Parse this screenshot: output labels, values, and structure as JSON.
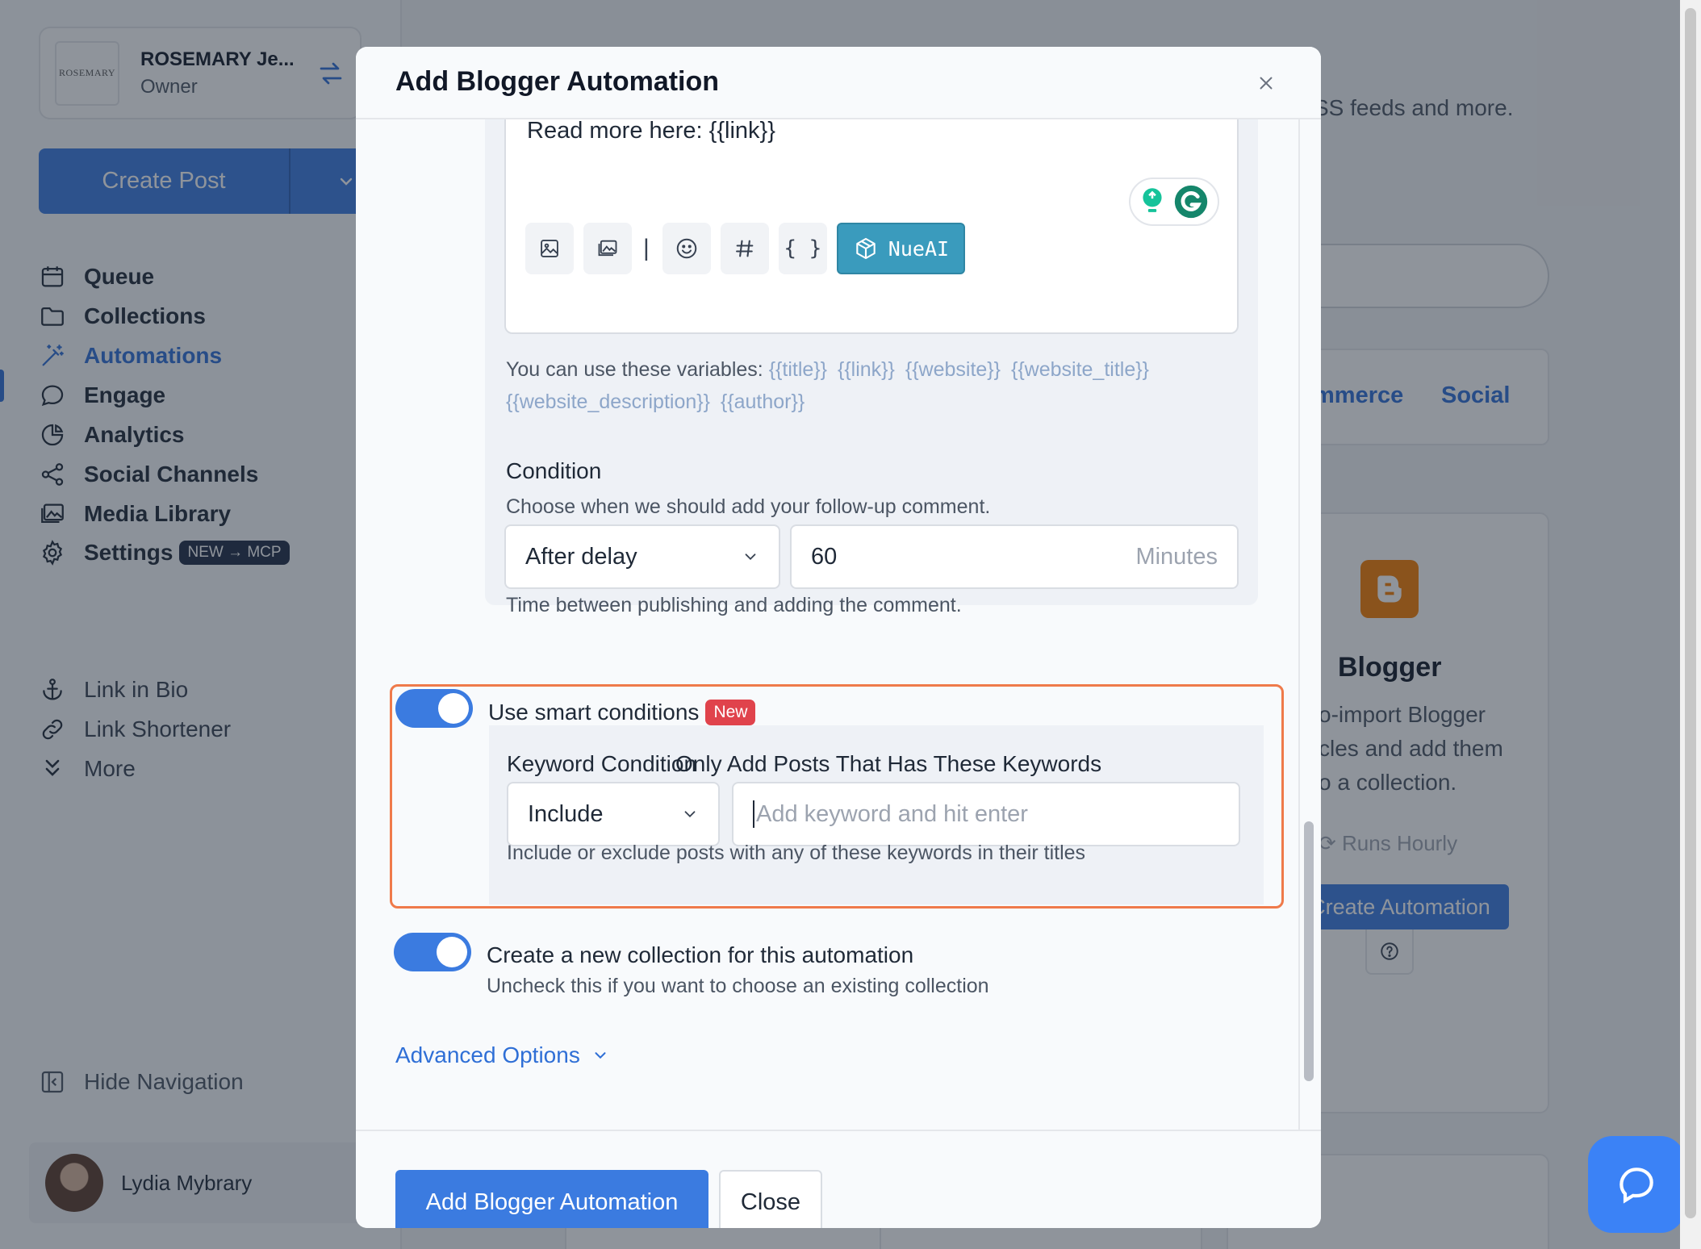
{
  "account": {
    "name": "ROSEMARY Je...",
    "role": "Owner",
    "logo_text": "ROSEMARY"
  },
  "sidebar": {
    "create_post": "Create Post",
    "items": [
      {
        "label": "Queue",
        "icon": "calendar-icon"
      },
      {
        "label": "Collections",
        "icon": "folder-icon"
      },
      {
        "label": "Automations",
        "icon": "magic-wand-icon"
      },
      {
        "label": "Engage",
        "icon": "chat-bubble-icon"
      },
      {
        "label": "Analytics",
        "icon": "pie-chart-icon"
      },
      {
        "label": "Social Channels",
        "icon": "share-icon"
      },
      {
        "label": "Media Library",
        "icon": "images-icon"
      },
      {
        "label": "Settings",
        "icon": "gear-icon",
        "badge": "NEW → MCP"
      },
      {
        "label": "Link in Bio",
        "icon": "anchor-icon"
      },
      {
        "label": "Link Shortener",
        "icon": "link-icon"
      },
      {
        "label": "More",
        "icon": "chevrons-down-icon"
      }
    ],
    "hide_navigation": "Hide Navigation",
    "user_name": "Lydia Mybrary"
  },
  "background": {
    "intro_fragment": "SS feeds and more.",
    "tab_fragment_1": "mmerce",
    "tab_fragment_2": "Social",
    "card_title": "Blogger",
    "card_desc_1": "o-import Blogger",
    "card_desc_2": "cles and add them",
    "card_desc_3": "o a collection.",
    "card_runs": "Runs Hourly",
    "card_button": "Create Automation"
  },
  "modal": {
    "title": "Add Blogger Automation",
    "editor_text": "Read more here:  {{link}}",
    "nueai_label": "NueAI",
    "variables_prefix": "You can use these variables:",
    "variables": [
      "{{title}}",
      "{{link}}",
      "{{website}}",
      "{{website_title}}",
      "{{website_description}}",
      "{{author}}"
    ],
    "condition": {
      "label": "Condition",
      "help": "Choose when we should add your follow-up comment.",
      "selected": "After delay",
      "delay_value": "60",
      "delay_unit": "Minutes",
      "note": "Time between publishing and adding the comment."
    },
    "smart": {
      "label": "Use smart conditions",
      "badge": "New",
      "enabled": true,
      "keyword_condition_label": "Keyword Condition",
      "keyword_condition_value": "Include",
      "keywords_label": "Only Add Posts That Has These Keywords",
      "keywords_placeholder": "Add keyword and hit enter",
      "help": "Include or exclude posts with any of these keywords in their titles"
    },
    "collection": {
      "enabled": true,
      "label": "Create a new collection for this automation",
      "help": "Uncheck this if you want to choose an existing collection"
    },
    "advanced": "Advanced Options",
    "submit": "Add Blogger Automation",
    "close": "Close"
  },
  "colors": {
    "accent": "#3b7be0",
    "highlight_border": "#ef7a4a",
    "badge_red": "#e0434c",
    "nueai": "#3a9bbd",
    "blogger": "#f57d00"
  }
}
